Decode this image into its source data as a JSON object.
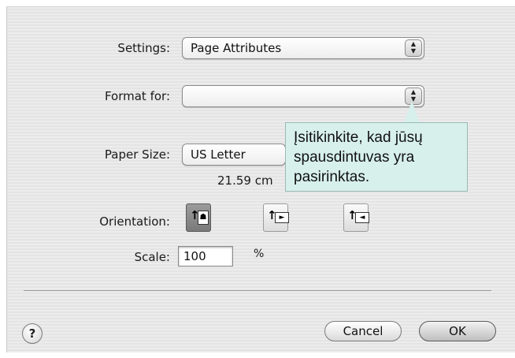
{
  "settings": {
    "label": "Settings:",
    "value": "Page Attributes"
  },
  "format_for": {
    "label": "Format for:",
    "value": ""
  },
  "paper_size": {
    "label": "Paper Size:",
    "value": "US Letter",
    "dimensions": "21.59 cm"
  },
  "orientation": {
    "label": "Orientation:",
    "options": [
      "portrait",
      "landscape-left",
      "landscape-right"
    ],
    "selected": "portrait"
  },
  "scale": {
    "label": "Scale:",
    "value": "100",
    "unit": "%"
  },
  "tooltip": {
    "text": "Įsitikinkite, kad jūsų spausdintuvas yra pasirinktas."
  },
  "buttons": {
    "help": "?",
    "cancel": "Cancel",
    "ok": "OK"
  }
}
